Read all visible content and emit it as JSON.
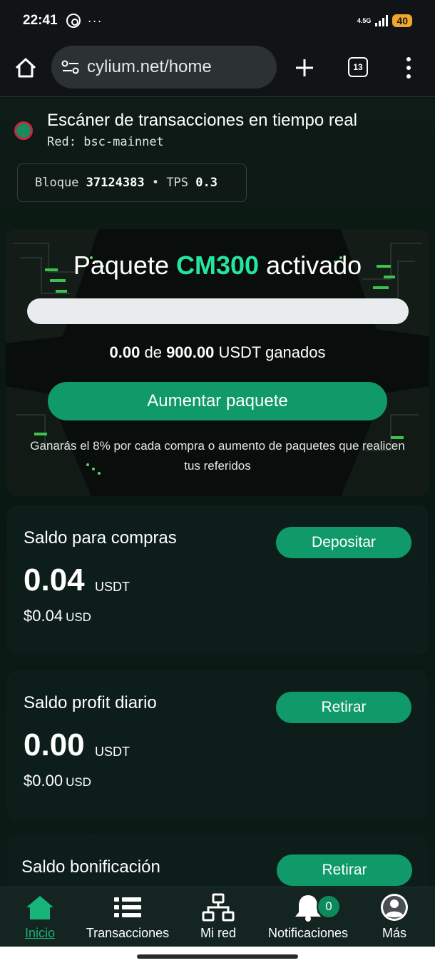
{
  "status_bar": {
    "time": "22:41",
    "more": "···",
    "network_type": "4.5G",
    "battery": "40"
  },
  "browser": {
    "url": "cylium.net/home",
    "tab_count": "13"
  },
  "scanner": {
    "title": "Escáner de transacciones en tiempo real",
    "network_label": "Red:",
    "network_value": "bsc-mainnet",
    "block_label": "Bloque",
    "block_value": "37124383",
    "separator": "•",
    "tps_label": "TPS",
    "tps_value": "0.3",
    "status_color": "#1b8a5e"
  },
  "package": {
    "title_prefix": "Paquete",
    "package_name": "CM300",
    "title_suffix": "activado",
    "progress_fraction": 0,
    "earned_value": "0.00",
    "earned_of": "de",
    "earned_total": "900.00",
    "earned_suffix": "USDT ganados",
    "upgrade_button": "Aumentar paquete",
    "note": "Ganarás el 8% por cada compra o aumento de paquetes que realicen tus referidos",
    "accent_color": "#25e6a0"
  },
  "balances": [
    {
      "title": "Saldo para compras",
      "button": "Depositar",
      "amount": "0.04",
      "currency": "USDT",
      "fiat": "$0.04",
      "fiat_currency": "USD"
    },
    {
      "title": "Saldo profit diario",
      "button": "Retirar",
      "amount": "0.00",
      "currency": "USDT",
      "fiat": "$0.00",
      "fiat_currency": "USD"
    },
    {
      "title": "Saldo bonificación",
      "button": "Retirar"
    }
  ],
  "nav": {
    "items": [
      {
        "label": "Inicio",
        "icon": "home-icon",
        "active": true
      },
      {
        "label": "Transacciones",
        "icon": "list-icon"
      },
      {
        "label": "Mi red",
        "icon": "network-icon"
      },
      {
        "label": "Notificaciones",
        "icon": "bell-icon"
      },
      {
        "label": "Más",
        "icon": "user-icon"
      }
    ],
    "notification_count": "0"
  },
  "colors": {
    "primary_button": "#109a6a",
    "active_nav": "#18b47a",
    "background": "#0c1512"
  }
}
